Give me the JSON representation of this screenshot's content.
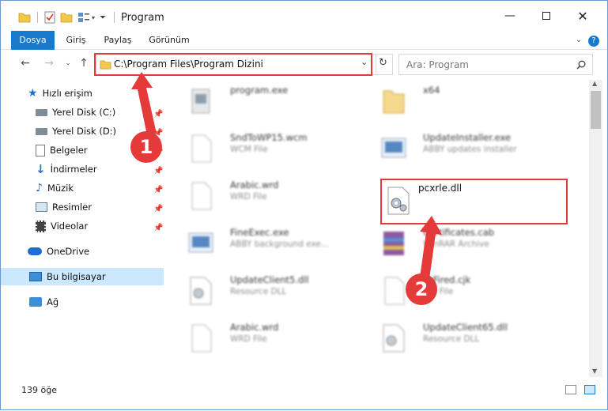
{
  "window": {
    "title": "Program"
  },
  "ribbon": {
    "tabs": [
      "Dosya",
      "Giriş",
      "Paylaş",
      "Görünüm"
    ]
  },
  "address": {
    "path": "C:\\Program Files\\Program Dizini"
  },
  "search": {
    "placeholder": "Ara: Program"
  },
  "sidebar": {
    "items": [
      {
        "label": "Hızlı erişim",
        "icon": "star-icon"
      },
      {
        "label": "Yerel Disk (C:)",
        "icon": "drive-icon",
        "pinned": true
      },
      {
        "label": "Yerel Disk (D:)",
        "icon": "drive-icon",
        "pinned": true
      },
      {
        "label": "Belgeler",
        "icon": "documents-icon",
        "pinned": true
      },
      {
        "label": "İndirmeler",
        "icon": "download-icon",
        "pinned": true
      },
      {
        "label": "Müzik",
        "icon": "music-icon",
        "pinned": true
      },
      {
        "label": "Resimler",
        "icon": "pictures-icon",
        "pinned": true
      },
      {
        "label": "Videolar",
        "icon": "video-icon",
        "pinned": true
      },
      {
        "label": "OneDrive",
        "icon": "cloud-icon"
      },
      {
        "label": "Bu bilgisayar",
        "icon": "computer-icon",
        "selected": true
      },
      {
        "label": "Ağ",
        "icon": "network-icon"
      }
    ]
  },
  "files": [
    {
      "name": "program.exe",
      "desc": ""
    },
    {
      "name": "x64",
      "desc": ""
    },
    {
      "name": "SndToWP15.wcm",
      "desc": "WCM File"
    },
    {
      "name": "UpdateInstaller.exe",
      "desc": "ABBY updates installer"
    },
    {
      "name": "Arabic.wrd",
      "desc": "WRD File"
    },
    {
      "name": "pcxrle.dll",
      "desc": ""
    },
    {
      "name": "FineExec.exe",
      "desc": "ABBY background exe..."
    },
    {
      "name": "Certificates.cab",
      "desc": "WinRAR Archive"
    },
    {
      "name": "UpdateClient5.dll",
      "desc": "Resource DLL"
    },
    {
      "name": "BrFired.cjk",
      "desc": "CJK File"
    },
    {
      "name": "Arabic.wrd",
      "desc": "WRD File"
    },
    {
      "name": "UpdateClient65.dll",
      "desc": "Resource DLL"
    }
  ],
  "status": {
    "count": "139 öğe"
  },
  "annotations": {
    "step1": "1",
    "step2": "2"
  },
  "colors": {
    "accent": "#1979ca",
    "highlight": "#e43a3a",
    "selected": "#cce8ff"
  }
}
